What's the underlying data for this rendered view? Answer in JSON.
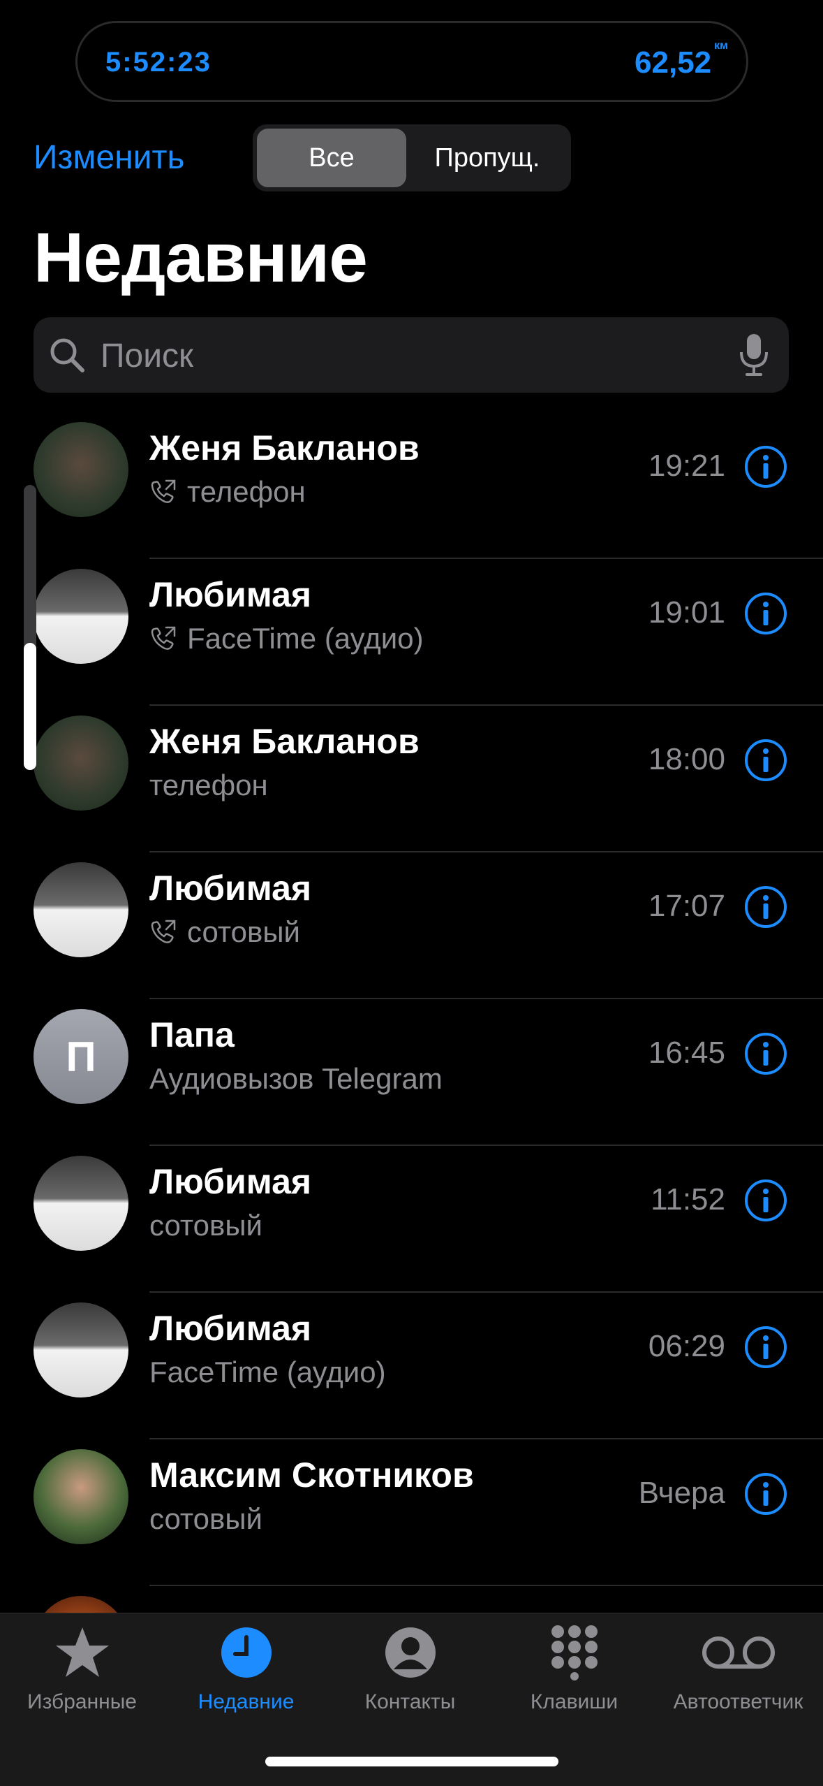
{
  "status": {
    "timer": "5:52:23",
    "distance": "62,52",
    "distance_unit": "км"
  },
  "header": {
    "edit_label": "Изменить",
    "segments": [
      "Все",
      "Пропущ."
    ],
    "title": "Недавние"
  },
  "search": {
    "placeholder": "Поиск"
  },
  "calls": [
    {
      "name": "Женя Бакланов",
      "detail": "телефон",
      "time": "19:21",
      "outgoing": true,
      "avatar": "photo"
    },
    {
      "name": "Любимая",
      "detail": "FaceTime (аудио)",
      "time": "19:01",
      "outgoing": true,
      "avatar": "photo"
    },
    {
      "name": "Женя Бакланов",
      "detail": "телефон",
      "time": "18:00",
      "outgoing": false,
      "avatar": "photo"
    },
    {
      "name": "Любимая",
      "detail": "сотовый",
      "time": "17:07",
      "outgoing": true,
      "avatar": "photo"
    },
    {
      "name": "Папа",
      "detail": "Аудиовызов Telegram",
      "time": "16:45",
      "outgoing": false,
      "avatar": "П"
    },
    {
      "name": "Любимая",
      "detail": "сотовый",
      "time": "11:52",
      "outgoing": false,
      "avatar": "photo"
    },
    {
      "name": "Любимая",
      "detail": "FaceTime (аудио)",
      "time": "06:29",
      "outgoing": false,
      "avatar": "photo"
    },
    {
      "name": "Максим Скотников",
      "detail": "сотовый",
      "time": "Вчера",
      "outgoing": false,
      "avatar": "photo"
    }
  ],
  "tabbar": {
    "tabs": [
      {
        "label": "Избранные",
        "icon": "star-icon",
        "active": false
      },
      {
        "label": "Недавние",
        "icon": "clock-icon",
        "active": true
      },
      {
        "label": "Контакты",
        "icon": "person-icon",
        "active": false
      },
      {
        "label": "Клавиши",
        "icon": "keypad-icon",
        "active": false
      },
      {
        "label": "Автоответчик",
        "icon": "voicemail-icon",
        "active": false
      }
    ]
  },
  "colors": {
    "accent": "#1c8cff",
    "secondary_text": "#8e8e93",
    "background": "#000000"
  }
}
